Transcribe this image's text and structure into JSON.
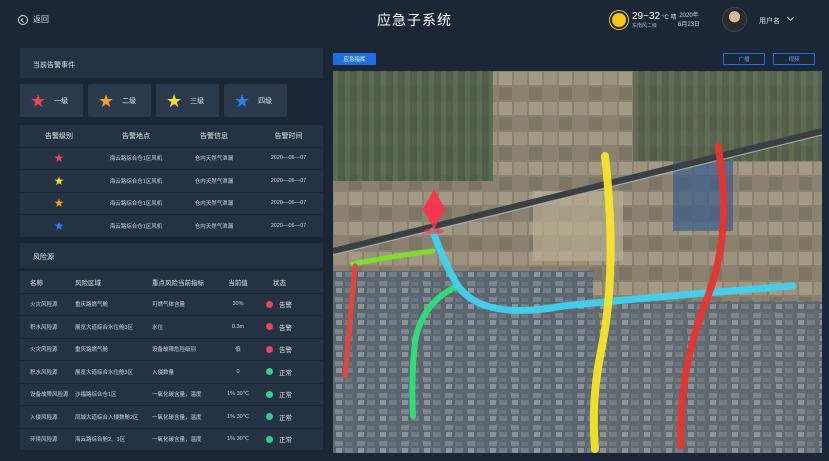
{
  "header": {
    "back_label": "返回",
    "title": "应急子系统",
    "weather": {
      "temp": "29~32",
      "unit": "°C 晴",
      "wind": "东南风二级",
      "icon": "sun-icon"
    },
    "date_year": "2020年",
    "date_day": "6月23日",
    "username": "用户名"
  },
  "alarm_panel": {
    "title": "当前告警事件",
    "levels": [
      {
        "label": "一级",
        "color": "#e8445a"
      },
      {
        "label": "二级",
        "color": "#f0a02a"
      },
      {
        "label": "三级",
        "color": "#f5e02a"
      },
      {
        "label": "四级",
        "color": "#2c7fe8"
      }
    ],
    "columns": [
      "告警级别",
      "告警地点",
      "告警信息",
      "告警时间"
    ],
    "rows": [
      {
        "color": "#e8445a",
        "location": "海云路综合仓1区风机",
        "info": "仓内天然气泄漏",
        "time": "2020—06—07"
      },
      {
        "color": "#f5e02a",
        "location": "海云路综合仓1区风机",
        "info": "仓内天然气泄漏",
        "time": "2020—06—07"
      },
      {
        "color": "#f0a02a",
        "location": "海云路综合仓1区风机",
        "info": "仓内天然气泄漏",
        "time": "2020—06—07"
      },
      {
        "color": "#2c7fe8",
        "location": "海云路综合仓1区风机",
        "info": "仓内天然气泄漏",
        "time": "2020—06—07"
      }
    ]
  },
  "risk_panel": {
    "title": "风险源",
    "columns": [
      "名称",
      "风险区域",
      "重点风险当前指标",
      "当前值",
      "状态"
    ],
    "rows": [
      {
        "name": "火灾风险源",
        "area": "重庆路燃气舱",
        "indicator": "可燃气体含量",
        "value": "30%",
        "status": "告警",
        "status_color": "#e8445a"
      },
      {
        "name": "积水风险源",
        "area": "展览大道综合水位舱3区",
        "indicator": "水位",
        "value": "0.3m",
        "status": "告警",
        "status_color": "#e8445a"
      },
      {
        "name": "火灾风险源",
        "area": "重庆路燃气舱",
        "indicator": "设备故障危险级别",
        "value": "低",
        "status": "告警",
        "status_color": "#e8445a"
      },
      {
        "name": "积水风险源",
        "area": "展览大道综合水位舱3区",
        "indicator": "入侵数量",
        "value": "0",
        "status": "正常",
        "status_color": "#2ecf8f"
      },
      {
        "name": "设备故障风险源",
        "area": "沙福路综合仓1区",
        "indicator": "一氧化碳含量，温度",
        "value": "1%  30℃",
        "status": "正常",
        "status_color": "#2ecf8f"
      },
      {
        "name": "入侵风险源",
        "area": "凤城大道综合入侵数舱2区",
        "indicator": "一氧化碳含量，温度",
        "value": "1%  30℃",
        "status": "正常",
        "status_color": "#2ecf8f"
      },
      {
        "name": "环境风险源",
        "area": "海云路综合舱2、3区",
        "indicator": "一氧化碳含量，温度",
        "value": "1%  30℃",
        "status": "正常",
        "status_color": "#2ecf8f"
      }
    ]
  },
  "map_panel": {
    "tag": "应急指挥",
    "broadcast_label": "广播",
    "video_label": "视频"
  }
}
